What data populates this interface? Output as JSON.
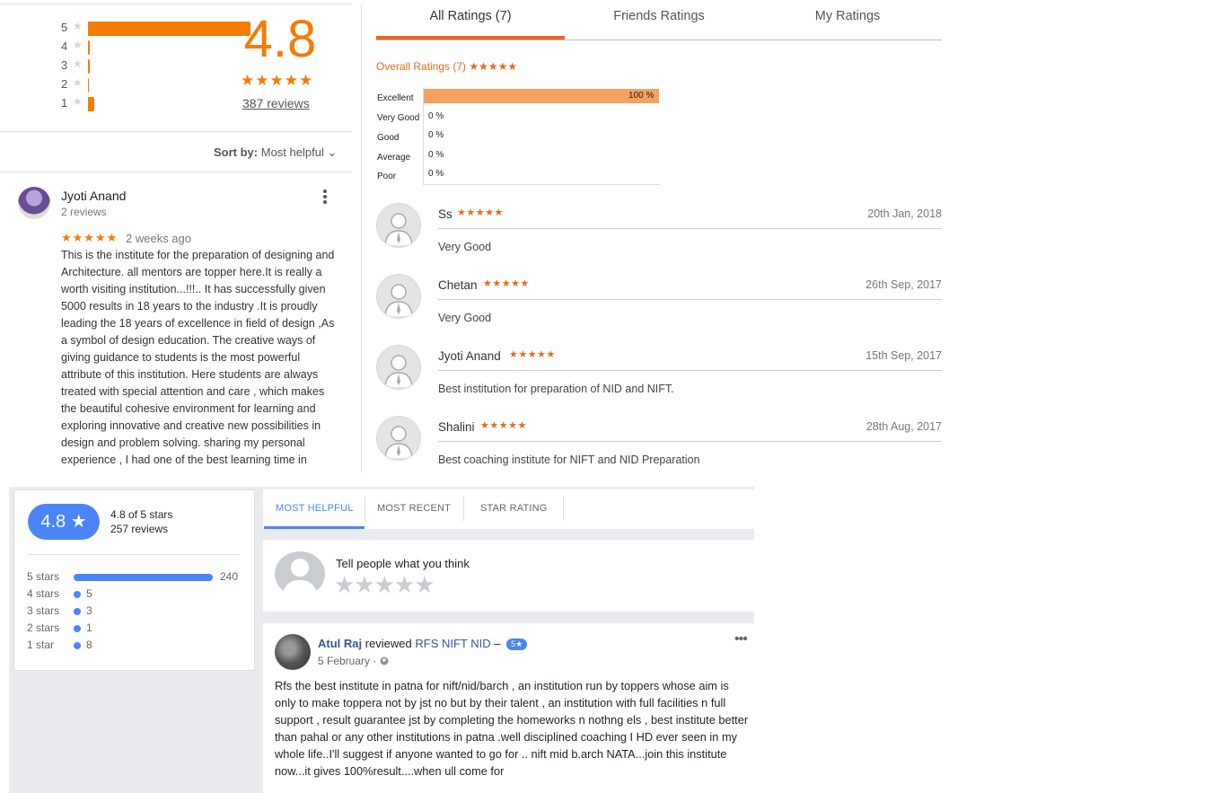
{
  "colors": {
    "orange": "#f57c00",
    "tab_orange": "#e8681f",
    "fb_blue": "#4a86f7",
    "fb_link": "#365899"
  },
  "panel_a": {
    "histogram": [
      {
        "stars": "5",
        "fraction": 0.97
      },
      {
        "stars": "4",
        "fraction": 0.01
      },
      {
        "stars": "3",
        "fraction": 0.01
      },
      {
        "stars": "2",
        "fraction": 0.005
      },
      {
        "stars": "1",
        "fraction": 0.04
      }
    ],
    "star_glyph": "★",
    "rating": "4.8",
    "rating_stars": "★★★★★",
    "reviews_link": "387 reviews",
    "sort_label": "Sort by:",
    "sort_value": "Most helpful",
    "sort_caret": "⌄",
    "review": {
      "author": "Jyoti Anand",
      "author_reviews": "2 reviews",
      "more_icon": "more-vert-icon",
      "stars": "★★★★★",
      "time": "2 weeks ago",
      "body": "This is the institute for the preparation of designing and Architecture. all mentors are topper here.It is really a worth visiting institution...!!!.. It has successfully given 5000 results in 18 years  to the industry .It is proudly leading the 18 years of excellence in field of design ,As a symbol of design education. The creative ways of giving guidance to students is the most powerful attribute of this institution. Here students are always treated with special attention and care , which makes the beautiful cohesive environment for learning and exploring innovative and creative new possibilities in design and problem solving. sharing my personal experience , I had one of the best learning time in"
    }
  },
  "panel_b": {
    "tabs": {
      "all": "All Ratings (7)",
      "friends": "Friends Ratings",
      "my": "My Ratings"
    },
    "overall": "Overall Ratings (7) ★★★★★",
    "distribution": [
      {
        "label": "Excellent",
        "value": "100 %",
        "fraction": 1.0
      },
      {
        "label": "Very Good",
        "value": "0 %",
        "fraction": 0
      },
      {
        "label": "Good",
        "value": "0 %",
        "fraction": 0
      },
      {
        "label": "Average",
        "value": "0 %",
        "fraction": 0
      },
      {
        "label": "Poor",
        "value": "0 %",
        "fraction": 0
      }
    ],
    "reviews": [
      {
        "name": "Ss",
        "stars": "★★★★★",
        "date": "20th Jan, 2018",
        "text": "Very Good"
      },
      {
        "name": "Chetan",
        "stars": "★★★★★",
        "date": "26th Sep, 2017",
        "text": "Very Good"
      },
      {
        "name": "Jyoti Anand",
        "stars": "★★★★★",
        "date": "15th Sep, 2017",
        "text": "Best institution for preparation of NID and NIFT."
      },
      {
        "name": "Shalini",
        "stars": "★★★★★",
        "date": "28th Aug, 2017",
        "text": "Best coaching institute for NIFT and NID Preparation"
      }
    ]
  },
  "panel_c": {
    "badge": "4.8 ★",
    "of_stars": "4.8 of 5 stars",
    "total_reviews": "257 reviews",
    "breakdown": [
      {
        "label": "5 stars",
        "count": "240",
        "fraction": 1.0
      },
      {
        "label": "4 stars",
        "count": "5",
        "fraction": 0.02
      },
      {
        "label": "3 stars",
        "count": "3",
        "fraction": 0.0125
      },
      {
        "label": "2 stars",
        "count": "1",
        "fraction": 0.004
      },
      {
        "label": "1 star",
        "count": "8",
        "fraction": 0.033
      }
    ],
    "tabs": {
      "helpful": "MOST HELPFUL",
      "recent": "MOST RECENT",
      "star": "STAR RATING"
    },
    "prompt": "Tell people what you think",
    "empty_stars": "★★★★★",
    "post": {
      "author": "Atul Raj",
      "action": " reviewed ",
      "page": "RFS NIFT NID",
      "dash": " – ",
      "pill": "5★",
      "date": "5 February ·",
      "globe_icon": "globe-icon",
      "more": "•••",
      "body": "Rfs the best institute in patna for nift/nid/barch , an institution run by toppers whose aim is only to make toppera not by jst no but by their talent , an institution with full facilities n full support , result guarantee jst by completing the homeworks n nothng els , best institute better than pahal or any other institutions in patna .well disciplined coaching I HD ever seen in my whole life..I'll suggest if anyone wanted to go for .. nift mid b.arch NATA...join this institute now...it gives 100%result....when ull come for"
    }
  }
}
